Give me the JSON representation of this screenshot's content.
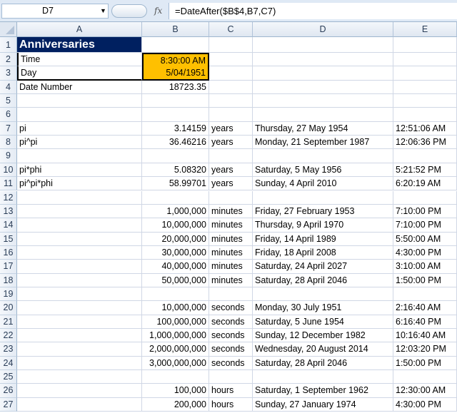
{
  "formula_bar": {
    "name_box": "D7",
    "fx_label": "fx",
    "formula": "=DateAfter($B$4,B7,C7)"
  },
  "columns": [
    "A",
    "B",
    "C",
    "D",
    "E"
  ],
  "rows": [
    {
      "n": "1",
      "cells": [
        "Anniversaries",
        "",
        "",
        "",
        ""
      ]
    },
    {
      "n": "2",
      "cells": [
        "Time",
        "8:30:00 AM",
        "",
        "",
        ""
      ]
    },
    {
      "n": "3",
      "cells": [
        "Day",
        "5/04/1951",
        "",
        "",
        ""
      ]
    },
    {
      "n": "4",
      "cells": [
        "Date Number",
        "18723.35",
        "",
        "",
        ""
      ]
    },
    {
      "n": "5",
      "cells": [
        "",
        "",
        "",
        "",
        ""
      ]
    },
    {
      "n": "6",
      "cells": [
        "",
        "",
        "",
        "",
        ""
      ]
    },
    {
      "n": "7",
      "cells": [
        "pi",
        "3.14159",
        "years",
        "Thursday, 27 May 1954",
        "12:51:06 AM"
      ]
    },
    {
      "n": "8",
      "cells": [
        "pi^pi",
        "36.46216",
        "years",
        "Monday, 21 September 1987",
        "12:06:36 PM"
      ]
    },
    {
      "n": "9",
      "cells": [
        "",
        "",
        "",
        "",
        ""
      ]
    },
    {
      "n": "10",
      "cells": [
        "pi*phi",
        "5.08320",
        "years",
        "Saturday, 5 May 1956",
        "5:21:52 PM"
      ]
    },
    {
      "n": "11",
      "cells": [
        "pi^pi*phi",
        "58.99701",
        "years",
        "Sunday, 4 April 2010",
        "6:20:19 AM"
      ]
    },
    {
      "n": "12",
      "cells": [
        "",
        "",
        "",
        "",
        ""
      ]
    },
    {
      "n": "13",
      "cells": [
        "",
        "1,000,000",
        "minutes",
        "Friday, 27 February 1953",
        "7:10:00 PM"
      ]
    },
    {
      "n": "14",
      "cells": [
        "",
        "10,000,000",
        "minutes",
        "Thursday, 9 April 1970",
        "7:10:00 PM"
      ]
    },
    {
      "n": "15",
      "cells": [
        "",
        "20,000,000",
        "minutes",
        "Friday, 14 April 1989",
        "5:50:00 AM"
      ]
    },
    {
      "n": "16",
      "cells": [
        "",
        "30,000,000",
        "minutes",
        "Friday, 18 April 2008",
        "4:30:00 PM"
      ]
    },
    {
      "n": "17",
      "cells": [
        "",
        "40,000,000",
        "minutes",
        "Saturday, 24 April 2027",
        "3:10:00 AM"
      ]
    },
    {
      "n": "18",
      "cells": [
        "",
        "50,000,000",
        "minutes",
        "Saturday, 28 April 2046",
        "1:50:00 PM"
      ]
    },
    {
      "n": "19",
      "cells": [
        "",
        "",
        "",
        "",
        ""
      ]
    },
    {
      "n": "20",
      "cells": [
        "",
        "10,000,000",
        "seconds",
        "Monday, 30 July 1951",
        "2:16:40 AM"
      ]
    },
    {
      "n": "21",
      "cells": [
        "",
        "100,000,000",
        "seconds",
        "Saturday, 5 June 1954",
        "6:16:40 PM"
      ]
    },
    {
      "n": "22",
      "cells": [
        "",
        "1,000,000,000",
        "seconds",
        "Sunday, 12 December 1982",
        "10:16:40 AM"
      ]
    },
    {
      "n": "23",
      "cells": [
        "",
        "2,000,000,000",
        "seconds",
        "Wednesday, 20 August 2014",
        "12:03:20 PM"
      ]
    },
    {
      "n": "24",
      "cells": [
        "",
        "3,000,000,000",
        "seconds",
        "Saturday, 28 April 2046",
        "1:50:00 PM"
      ]
    },
    {
      "n": "25",
      "cells": [
        "",
        "",
        "",
        "",
        ""
      ]
    },
    {
      "n": "26",
      "cells": [
        "",
        "100,000",
        "hours",
        "Saturday, 1 September 1962",
        "12:30:00 AM"
      ]
    },
    {
      "n": "27",
      "cells": [
        "",
        "200,000",
        "hours",
        "Sunday, 27 January 1974",
        "4:30:00 PM"
      ]
    }
  ],
  "colors": {
    "title_bg": "#002060",
    "input_bg": "#ffc000"
  }
}
